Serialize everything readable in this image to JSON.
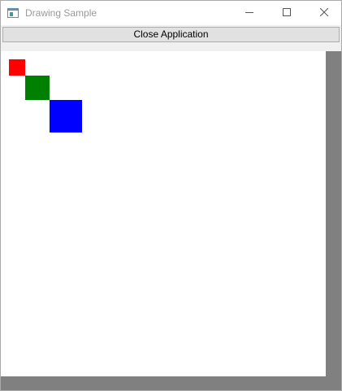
{
  "window": {
    "title": "Drawing Sample",
    "icon": "app-window-icon",
    "controls": {
      "minimize_icon": "minimize-icon",
      "maximize_icon": "maximize-icon",
      "close_icon": "close-icon"
    }
  },
  "toolbar": {
    "close_label": "Close Application"
  },
  "drawing": {
    "shapes": [
      {
        "shape": "square",
        "color": "#ff0000"
      },
      {
        "shape": "square",
        "color": "#008000"
      },
      {
        "shape": "square",
        "color": "#0000ff"
      }
    ]
  },
  "colors": {
    "scrollbar": "#808080",
    "canvas": "#ffffff"
  }
}
